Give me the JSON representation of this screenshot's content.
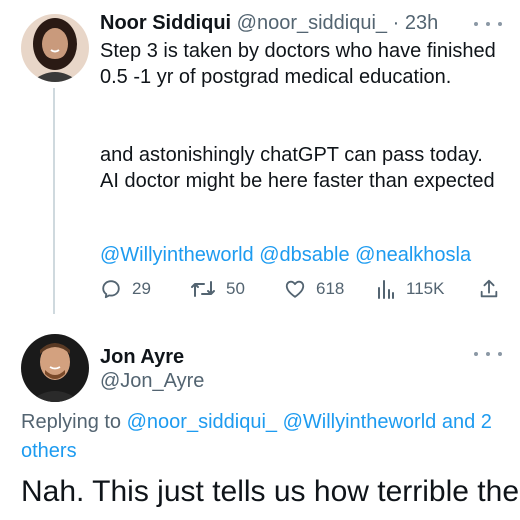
{
  "tweet": {
    "author_name": "Noor Siddiqui",
    "author_handle": "@noor_siddiqui_",
    "separator": "·",
    "time": "23h",
    "paragraph_1": "Step 3 is taken by doctors who have finished 0.5 -1 yr of postgrad medical education.",
    "paragraph_2": "and astonishingly chatGPT can pass today. AI doctor might be here faster than expected",
    "mentions": "@Willyintheworld @dbsable @nealkhosla",
    "stats": {
      "replies": "29",
      "retweets": "50",
      "likes": "618",
      "views": "115K"
    }
  },
  "reply": {
    "author_name": "Jon Ayre",
    "author_handle": "@Jon_Ayre",
    "replying_prefix": "Replying to",
    "replying_to_1": "@noor_siddiqui_",
    "replying_to_2": "@Willyintheworld",
    "replying_others": "and 2 others",
    "text": "Nah. This just tells us how terrible the"
  },
  "icons": {
    "reply": "reply-icon",
    "retweet": "retweet-icon",
    "like": "heart-icon",
    "views": "views-icon",
    "share": "share-icon",
    "more": "more-icon"
  },
  "colors": {
    "link": "#1d9bf0",
    "muted": "#536471",
    "text": "#0f1419",
    "thread_line": "#cfd9de"
  }
}
